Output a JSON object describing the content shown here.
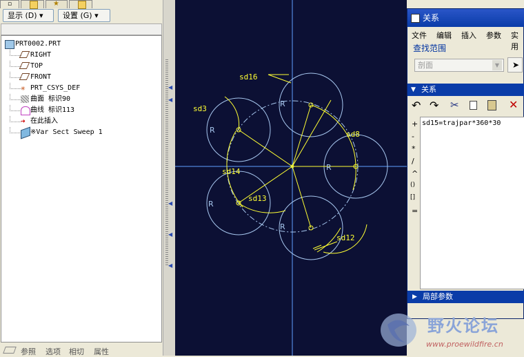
{
  "left_panel": {
    "show_button": "显示 (D) ▾",
    "settings_button": "设置 (G) ▾",
    "tree": [
      {
        "label": "PRT0002.PRT",
        "icon": "part-icon"
      },
      {
        "label": "RIGHT",
        "icon": "datum-plane-icon"
      },
      {
        "label": "TOP",
        "icon": "datum-plane-icon"
      },
      {
        "label": "FRONT",
        "icon": "datum-plane-icon"
      },
      {
        "label": "PRT_CSYS_DEF",
        "icon": "csys-icon"
      },
      {
        "label": "曲面 标识90",
        "icon": "surface-icon"
      },
      {
        "label": "曲线 标识113",
        "icon": "curve-icon"
      },
      {
        "label": "在此插入",
        "icon": "insert-arrow-icon"
      },
      {
        "label": "※Var Sect Sweep 1",
        "icon": "sweep-icon"
      }
    ],
    "bottom_tabs": [
      "参照",
      "选项",
      "相切",
      "属性"
    ]
  },
  "canvas": {
    "labels": {
      "sd16": "sd16",
      "sd3": "sd3",
      "sd8": "sd8",
      "sd14": "sd14",
      "sd13": "sd13",
      "sd12": "sd12",
      "r": "R"
    },
    "colors": {
      "background": "#0c1034",
      "circle": "#a8c8f0",
      "dim": "#ffff33",
      "axis": "#5fa0ff"
    }
  },
  "dialog": {
    "title": "关系",
    "menu": [
      "文件",
      "编辑",
      "插入",
      "参数",
      "实用"
    ],
    "search_label": "查找范围",
    "scope_value": "剖面",
    "relations_header": "关系",
    "relation_text": "sd15=trajpar*360*30",
    "ops": [
      "+",
      "-",
      "*",
      "/",
      "^",
      "()",
      "[]",
      "="
    ],
    "local_params": "局部参数"
  },
  "watermark": {
    "name": "野火论坛",
    "url": "www.proewildfire.cn"
  }
}
